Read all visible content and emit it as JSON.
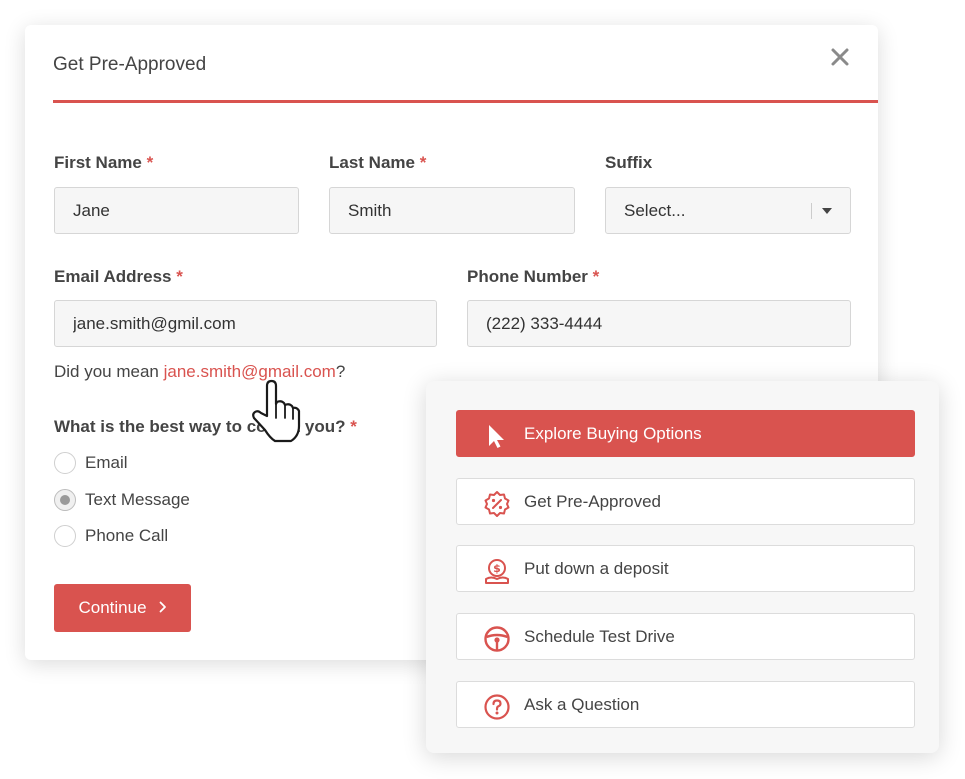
{
  "colors": {
    "accent": "#d9534f",
    "text": "#444444",
    "input_bg": "#f6f6f6"
  },
  "modal": {
    "title": "Get Pre-Approved",
    "close_icon": "close-icon",
    "first_name": {
      "label": "First Name",
      "required": "*",
      "value": "Jane"
    },
    "last_name": {
      "label": "Last Name",
      "required": "*",
      "value": "Smith"
    },
    "suffix": {
      "label": "Suffix",
      "value": "Select..."
    },
    "email": {
      "label": "Email Address",
      "required": "*",
      "value": "jane.smith@gmil.com"
    },
    "phone": {
      "label": "Phone Number",
      "required": "*",
      "value": "(222) 333-4444"
    },
    "suggestion": {
      "prefix": "Did you mean ",
      "link": "jane.smith@gmail.com",
      "suffix": "?"
    },
    "contact": {
      "question": "What is the best way to co",
      "question_tail": "t you?",
      "required": "*",
      "options": [
        {
          "label": "Email",
          "checked": false
        },
        {
          "label": "Text Message",
          "checked": true
        },
        {
          "label": "Phone Call",
          "checked": false
        }
      ]
    },
    "continue_label": "Continue",
    "continue_icon": "chevron-right-icon"
  },
  "options_panel": {
    "items": [
      {
        "label": "Explore Buying Options",
        "icon": "pointer-icon",
        "active": true
      },
      {
        "label": "Get Pre-Approved",
        "icon": "percent-badge-icon",
        "active": false
      },
      {
        "label": "Put down a deposit",
        "icon": "dollar-hand-icon",
        "active": false
      },
      {
        "label": "Schedule Test Drive",
        "icon": "steering-wheel-icon",
        "active": false
      },
      {
        "label": "Ask a Question",
        "icon": "question-circle-icon",
        "active": false
      }
    ]
  }
}
